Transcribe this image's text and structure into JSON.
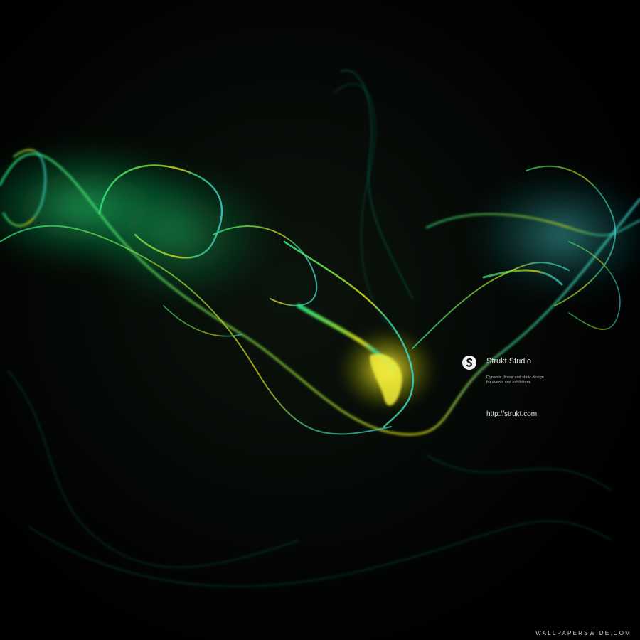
{
  "brand": {
    "name": "Strukt Studio",
    "tagline_line1": "Dynamic, linear and static design",
    "tagline_line2": "for events and exhibitions",
    "url": "http://strukt.com",
    "logo_icon": "strukt-s-logo-icon"
  },
  "watermark": "WALLPAPERSWIDE.COM",
  "colors": {
    "background": "#000000",
    "smoke_green": "#2ee07a",
    "smoke_yellow": "#e6e01a",
    "smoke_cyan": "#3fd6d0"
  }
}
